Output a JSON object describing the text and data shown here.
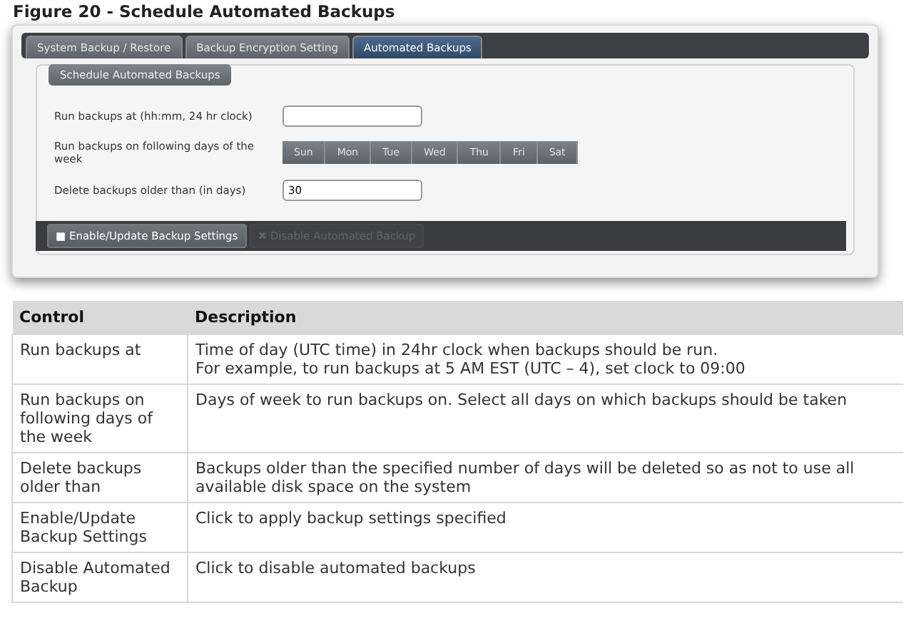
{
  "figure_caption": "Figure 20 - Schedule Automated Backups",
  "tabs": [
    {
      "label": "System Backup / Restore",
      "selected": false
    },
    {
      "label": "Backup Encryption Setting",
      "selected": false
    },
    {
      "label": "Automated Backups",
      "selected": true
    }
  ],
  "section_title": "Schedule Automated Backups",
  "fields": [
    {
      "kind": "text",
      "label": "Run backups at (hh:mm, 24 hr clock)"
    },
    {
      "kind": "days",
      "label": "Run backups on following days of the week",
      "days": [
        {
          "label": "Sun",
          "selected": false
        },
        {
          "label": "Mon",
          "selected": false
        },
        {
          "label": "Tue",
          "selected": false
        },
        {
          "label": "Wed",
          "selected": false
        },
        {
          "label": "Thu",
          "selected": false
        },
        {
          "label": "Fri",
          "selected": false
        },
        {
          "label": "Sat",
          "selected": false
        }
      ]
    },
    {
      "kind": "text",
      "label": "Delete backups older than (in days)",
      "value": "30"
    }
  ],
  "actions": [
    {
      "icon": "■",
      "label": "Enable/Update Backup Settings",
      "disabled": false
    },
    {
      "icon": "✖",
      "label": "Disable Automated Backup",
      "disabled": true
    }
  ],
  "table": {
    "columns": [
      "Control",
      "Description"
    ],
    "rows": [
      [
        "Run backups at",
        "Time of day (UTC time) in 24hr clock when backups should be run.\nFor example, to run backups at 5 AM EST (UTC – 4), set clock to 09:00"
      ],
      [
        "Run backups on following days of the week",
        "Days of week to run backups on. Select all days on which backups should be taken"
      ],
      [
        "Delete backups older than",
        "Backups older than the specified number of days will be deleted so as not to use all available disk space on the system"
      ],
      [
        "Enable/Update Backup Settings",
        "Click to apply backup settings specified"
      ],
      [
        "Disable Automated Backup",
        "Click to disable automated backups"
      ]
    ]
  }
}
